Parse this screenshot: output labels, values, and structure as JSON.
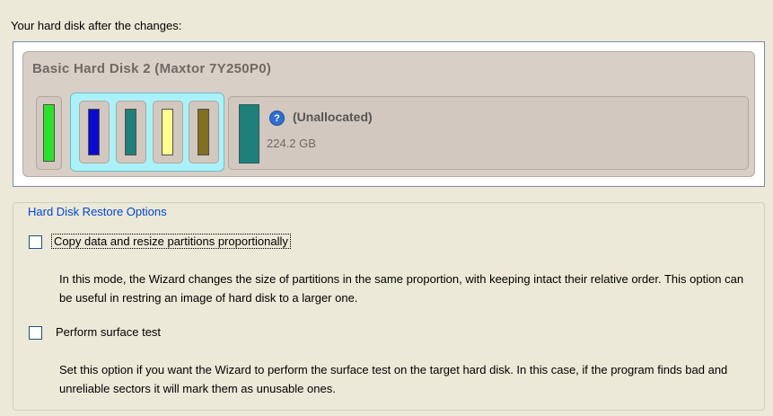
{
  "heading": "Your hard disk after the changes:",
  "disk": {
    "title": "Basic Hard Disk 2 (Maxtor 7Y250P0)",
    "partitions": [
      {
        "color": "#2ee02e"
      },
      {
        "color": "#0a0ad0"
      },
      {
        "color": "#1f7f7a"
      },
      {
        "color": "#ffff90"
      },
      {
        "color": "#807020"
      }
    ],
    "unallocated": {
      "label": "(Unallocated)",
      "size": "224.2 GB",
      "color": "#1f7f7a",
      "icon": "help-icon"
    }
  },
  "options": {
    "legend": "Hard Disk Restore Options",
    "copy_resize": {
      "label": "Copy data and resize partitions proportionally",
      "checked": false,
      "description": "In this mode, the Wizard changes the size of partitions in the same proportion, with keeping intact their relative order. This option can be useful in restring an image of hard disk to a larger one."
    },
    "surface_test": {
      "label": "Perform surface test",
      "checked": false,
      "description": "Set this option if you want the Wizard to perform the surface test on the target hard disk. In this case, if the program finds bad and unreliable sectors it will mark them as unusable ones."
    }
  },
  "colors": {
    "accent": "#0046d5",
    "extended_group": "#aaf2fa"
  }
}
